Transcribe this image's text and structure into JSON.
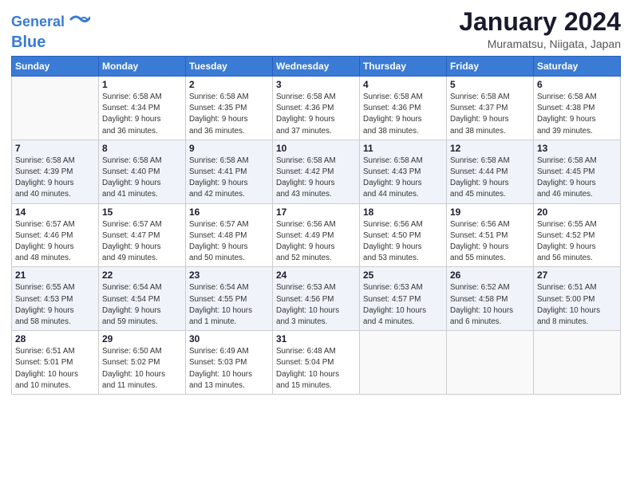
{
  "header": {
    "logo_line1": "General",
    "logo_line2": "Blue",
    "title": "January 2024",
    "subtitle": "Muramatsu, Niigata, Japan"
  },
  "columns": [
    "Sunday",
    "Monday",
    "Tuesday",
    "Wednesday",
    "Thursday",
    "Friday",
    "Saturday"
  ],
  "weeks": [
    {
      "shade": false,
      "days": [
        {
          "num": "",
          "info": ""
        },
        {
          "num": "1",
          "info": "Sunrise: 6:58 AM\nSunset: 4:34 PM\nDaylight: 9 hours\nand 36 minutes."
        },
        {
          "num": "2",
          "info": "Sunrise: 6:58 AM\nSunset: 4:35 PM\nDaylight: 9 hours\nand 36 minutes."
        },
        {
          "num": "3",
          "info": "Sunrise: 6:58 AM\nSunset: 4:36 PM\nDaylight: 9 hours\nand 37 minutes."
        },
        {
          "num": "4",
          "info": "Sunrise: 6:58 AM\nSunset: 4:36 PM\nDaylight: 9 hours\nand 38 minutes."
        },
        {
          "num": "5",
          "info": "Sunrise: 6:58 AM\nSunset: 4:37 PM\nDaylight: 9 hours\nand 38 minutes."
        },
        {
          "num": "6",
          "info": "Sunrise: 6:58 AM\nSunset: 4:38 PM\nDaylight: 9 hours\nand 39 minutes."
        }
      ]
    },
    {
      "shade": true,
      "days": [
        {
          "num": "7",
          "info": "Sunrise: 6:58 AM\nSunset: 4:39 PM\nDaylight: 9 hours\nand 40 minutes."
        },
        {
          "num": "8",
          "info": "Sunrise: 6:58 AM\nSunset: 4:40 PM\nDaylight: 9 hours\nand 41 minutes."
        },
        {
          "num": "9",
          "info": "Sunrise: 6:58 AM\nSunset: 4:41 PM\nDaylight: 9 hours\nand 42 minutes."
        },
        {
          "num": "10",
          "info": "Sunrise: 6:58 AM\nSunset: 4:42 PM\nDaylight: 9 hours\nand 43 minutes."
        },
        {
          "num": "11",
          "info": "Sunrise: 6:58 AM\nSunset: 4:43 PM\nDaylight: 9 hours\nand 44 minutes."
        },
        {
          "num": "12",
          "info": "Sunrise: 6:58 AM\nSunset: 4:44 PM\nDaylight: 9 hours\nand 45 minutes."
        },
        {
          "num": "13",
          "info": "Sunrise: 6:58 AM\nSunset: 4:45 PM\nDaylight: 9 hours\nand 46 minutes."
        }
      ]
    },
    {
      "shade": false,
      "days": [
        {
          "num": "14",
          "info": "Sunrise: 6:57 AM\nSunset: 4:46 PM\nDaylight: 9 hours\nand 48 minutes."
        },
        {
          "num": "15",
          "info": "Sunrise: 6:57 AM\nSunset: 4:47 PM\nDaylight: 9 hours\nand 49 minutes."
        },
        {
          "num": "16",
          "info": "Sunrise: 6:57 AM\nSunset: 4:48 PM\nDaylight: 9 hours\nand 50 minutes."
        },
        {
          "num": "17",
          "info": "Sunrise: 6:56 AM\nSunset: 4:49 PM\nDaylight: 9 hours\nand 52 minutes."
        },
        {
          "num": "18",
          "info": "Sunrise: 6:56 AM\nSunset: 4:50 PM\nDaylight: 9 hours\nand 53 minutes."
        },
        {
          "num": "19",
          "info": "Sunrise: 6:56 AM\nSunset: 4:51 PM\nDaylight: 9 hours\nand 55 minutes."
        },
        {
          "num": "20",
          "info": "Sunrise: 6:55 AM\nSunset: 4:52 PM\nDaylight: 9 hours\nand 56 minutes."
        }
      ]
    },
    {
      "shade": true,
      "days": [
        {
          "num": "21",
          "info": "Sunrise: 6:55 AM\nSunset: 4:53 PM\nDaylight: 9 hours\nand 58 minutes."
        },
        {
          "num": "22",
          "info": "Sunrise: 6:54 AM\nSunset: 4:54 PM\nDaylight: 9 hours\nand 59 minutes."
        },
        {
          "num": "23",
          "info": "Sunrise: 6:54 AM\nSunset: 4:55 PM\nDaylight: 10 hours\nand 1 minute."
        },
        {
          "num": "24",
          "info": "Sunrise: 6:53 AM\nSunset: 4:56 PM\nDaylight: 10 hours\nand 3 minutes."
        },
        {
          "num": "25",
          "info": "Sunrise: 6:53 AM\nSunset: 4:57 PM\nDaylight: 10 hours\nand 4 minutes."
        },
        {
          "num": "26",
          "info": "Sunrise: 6:52 AM\nSunset: 4:58 PM\nDaylight: 10 hours\nand 6 minutes."
        },
        {
          "num": "27",
          "info": "Sunrise: 6:51 AM\nSunset: 5:00 PM\nDaylight: 10 hours\nand 8 minutes."
        }
      ]
    },
    {
      "shade": false,
      "days": [
        {
          "num": "28",
          "info": "Sunrise: 6:51 AM\nSunset: 5:01 PM\nDaylight: 10 hours\nand 10 minutes."
        },
        {
          "num": "29",
          "info": "Sunrise: 6:50 AM\nSunset: 5:02 PM\nDaylight: 10 hours\nand 11 minutes."
        },
        {
          "num": "30",
          "info": "Sunrise: 6:49 AM\nSunset: 5:03 PM\nDaylight: 10 hours\nand 13 minutes."
        },
        {
          "num": "31",
          "info": "Sunrise: 6:48 AM\nSunset: 5:04 PM\nDaylight: 10 hours\nand 15 minutes."
        },
        {
          "num": "",
          "info": ""
        },
        {
          "num": "",
          "info": ""
        },
        {
          "num": "",
          "info": ""
        }
      ]
    }
  ]
}
